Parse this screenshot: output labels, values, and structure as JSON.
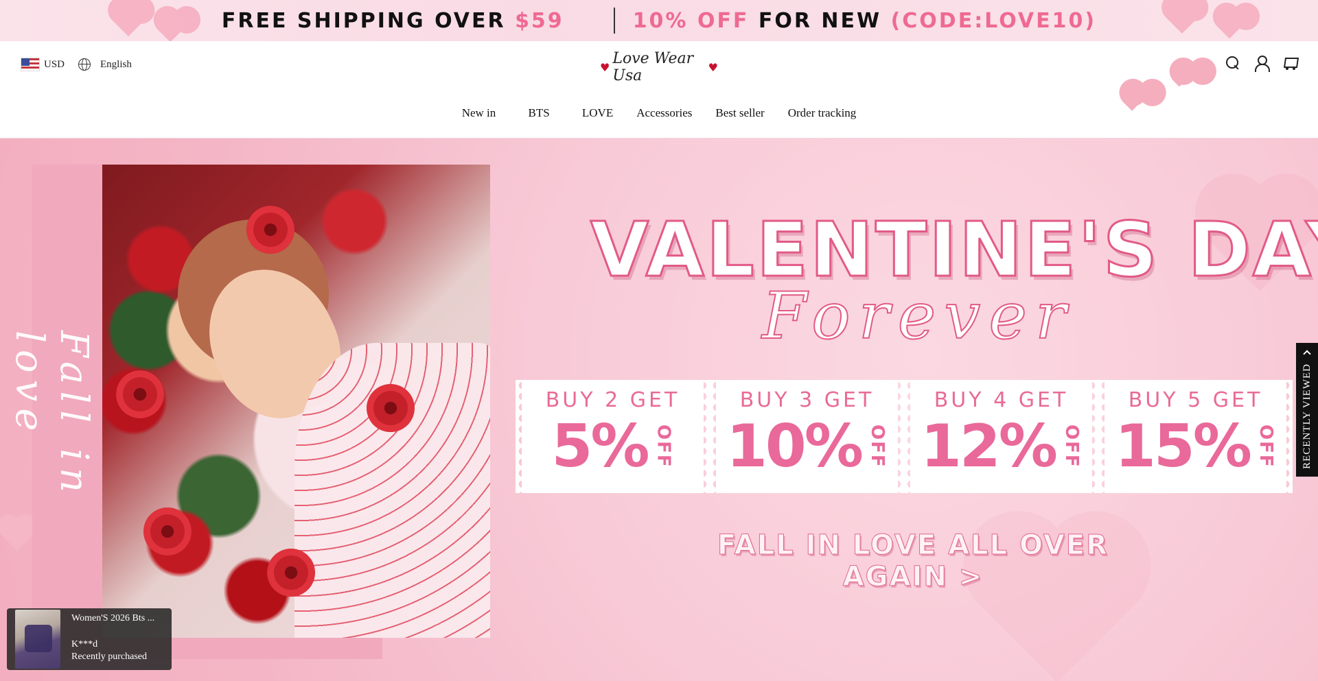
{
  "announcement": {
    "shipping_prefix": "FREE SHIPPING OVER ",
    "shipping_amount": "$59",
    "discount_pct": "10% OFF",
    "discount_mid": " FOR NEW ",
    "discount_code": "(CODE:LOVE10)"
  },
  "header": {
    "currency": "USD",
    "language": "English",
    "logo_text": "Love Wear Usa",
    "nav": [
      "New in",
      "\u0000BTS\u0000",
      "LOVE",
      "Accessories",
      "Best seller",
      "Order tracking"
    ]
  },
  "hero": {
    "side_script": "Fall in love",
    "title": "VALENTINE'S DAY",
    "subtitle": "Forever",
    "coupons": [
      {
        "buy": "BUY 2 GET",
        "amount": "5%",
        "off": "OFF"
      },
      {
        "buy": "BUY 3 GET",
        "amount": "10%",
        "off": "OFF"
      },
      {
        "buy": "BUY 4 GET",
        "amount": "12%",
        "off": "OFF"
      },
      {
        "buy": "BUY 5 GET",
        "amount": "15%",
        "off": "OFF"
      }
    ],
    "cta": "FALL IN LOVE ALL OVER AGAIN >"
  },
  "recently_viewed": {
    "label": "RECENTLY VIEWED"
  },
  "purchase_popup": {
    "product": "Women'S 2026 Bts ...",
    "buyer": "K***d",
    "status": "Recently purchased"
  },
  "colors": {
    "accent_pink": "#ee6a93",
    "strip_pink": "#f0a9bd",
    "tab_black": "#111111"
  }
}
